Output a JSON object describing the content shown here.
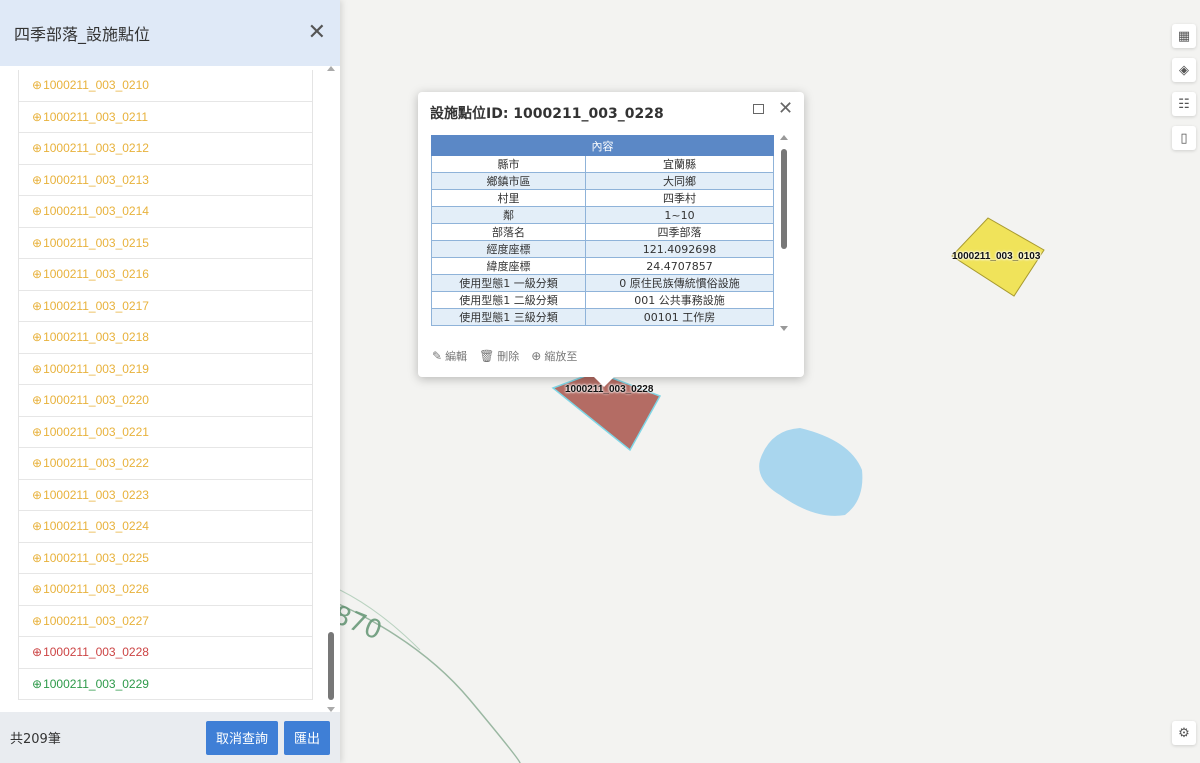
{
  "panel": {
    "title": "四季部落_設施點位",
    "close_glyph": "✕",
    "items": [
      {
        "id": "1000211_003_0210",
        "color": "#e8b23c"
      },
      {
        "id": "1000211_003_0211",
        "color": "#e8b23c"
      },
      {
        "id": "1000211_003_0212",
        "color": "#e8b23c"
      },
      {
        "id": "1000211_003_0213",
        "color": "#e8b23c"
      },
      {
        "id": "1000211_003_0214",
        "color": "#e8b23c"
      },
      {
        "id": "1000211_003_0215",
        "color": "#e8b23c"
      },
      {
        "id": "1000211_003_0216",
        "color": "#e8b23c"
      },
      {
        "id": "1000211_003_0217",
        "color": "#e8b23c"
      },
      {
        "id": "1000211_003_0218",
        "color": "#e8b23c"
      },
      {
        "id": "1000211_003_0219",
        "color": "#e8b23c"
      },
      {
        "id": "1000211_003_0220",
        "color": "#e8b23c"
      },
      {
        "id": "1000211_003_0221",
        "color": "#e8b23c"
      },
      {
        "id": "1000211_003_0222",
        "color": "#e8b23c"
      },
      {
        "id": "1000211_003_0223",
        "color": "#e8b23c"
      },
      {
        "id": "1000211_003_0224",
        "color": "#e8b23c"
      },
      {
        "id": "1000211_003_0225",
        "color": "#e8b23c"
      },
      {
        "id": "1000211_003_0226",
        "color": "#e8b23c"
      },
      {
        "id": "1000211_003_0227",
        "color": "#e8b23c"
      },
      {
        "id": "1000211_003_0228",
        "color": "#cc4444"
      },
      {
        "id": "1000211_003_0229",
        "color": "#2e9a4a"
      }
    ],
    "footer": {
      "count": "共209筆",
      "cancel_label": "取消查詢",
      "export_label": "匯出"
    }
  },
  "popup": {
    "title": "設施點位ID: 1000211_003_0228",
    "header": "內容",
    "rows": [
      {
        "key": "縣市",
        "value": "宜蘭縣"
      },
      {
        "key": "鄉鎮市區",
        "value": "大同鄉"
      },
      {
        "key": "村里",
        "value": "四季村"
      },
      {
        "key": "鄰",
        "value": "1~10"
      },
      {
        "key": "部落名",
        "value": "四季部落"
      },
      {
        "key": "經度座標",
        "value": "121.4092698"
      },
      {
        "key": "緯度座標",
        "value": "24.4707857"
      },
      {
        "key": "使用型態1 一級分類",
        "value": "0 原住民族傳統慣俗設施"
      },
      {
        "key": "使用型態1 二級分類",
        "value": "001 公共事務設施"
      },
      {
        "key": "使用型態1 三級分類",
        "value": "00101 工作房"
      }
    ],
    "actions": {
      "edit": "編輯",
      "delete": "刪除",
      "zoom": "縮放至"
    }
  },
  "map": {
    "labels": {
      "selected": "1000211_003_0228",
      "other": "1000211_003_0103",
      "contour": "870"
    },
    "colors": {
      "selected_fill": "#a8534b",
      "other_fill": "#f0e35a",
      "water": "#a9d6ee"
    }
  },
  "tools": [
    "qr-icon",
    "layers-icon",
    "legend-icon",
    "mouse-icon",
    "gear-icon"
  ]
}
